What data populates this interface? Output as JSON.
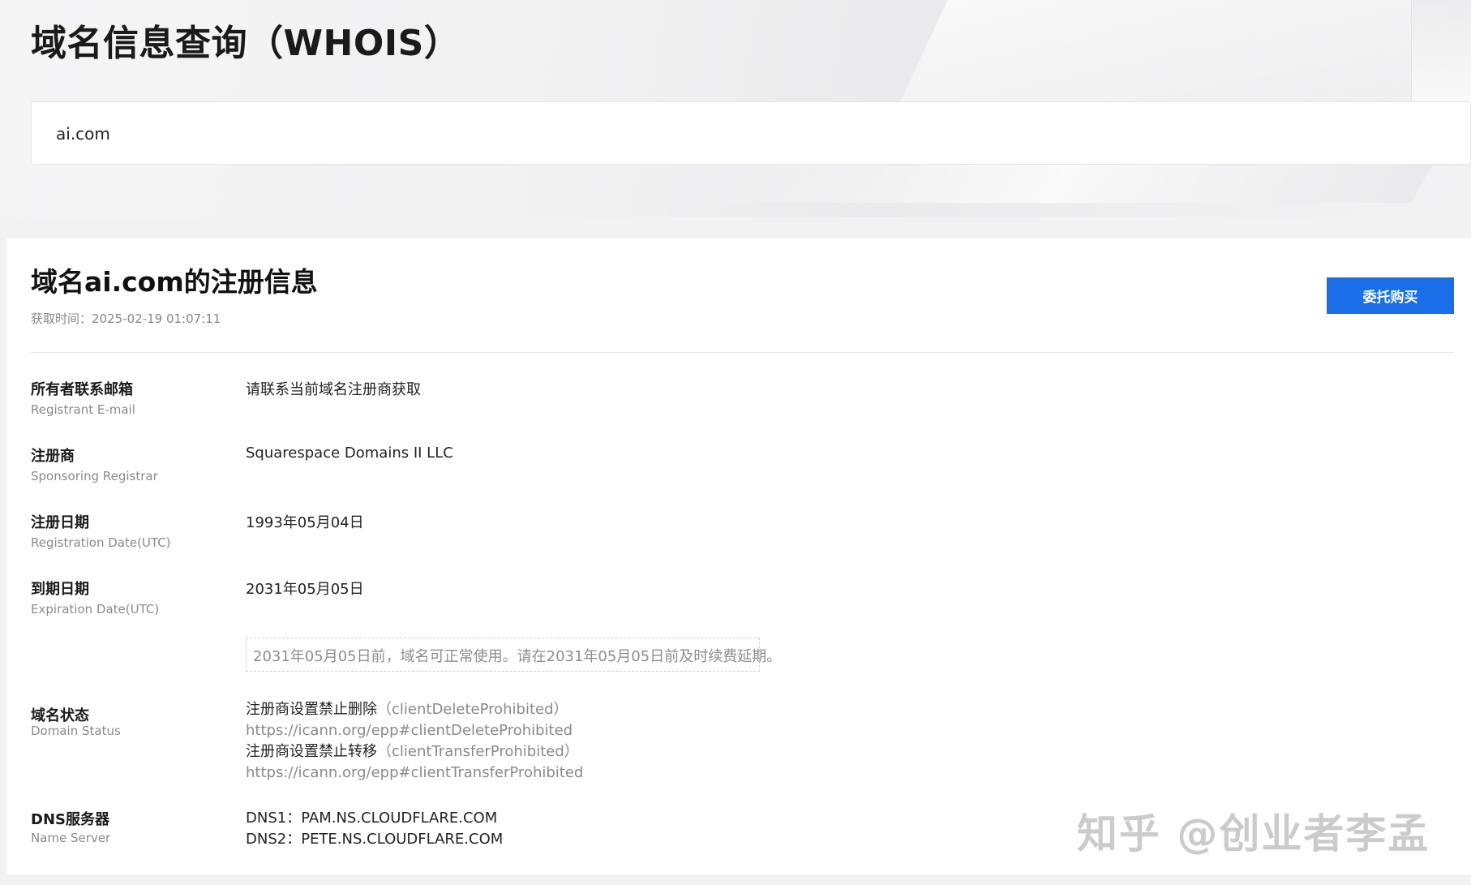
{
  "hero": {
    "title": "域名信息查询（WHOIS）",
    "search_value": "ai.com"
  },
  "result": {
    "title": "域名ai.com的注册信息",
    "fetch_time_label": "获取时间：",
    "fetch_time_value": "2025-02-19 01:07:11",
    "buy_button": "委托购买"
  },
  "fields": {
    "email": {
      "label_cn": "所有者联系邮箱",
      "label_en": "Registrant E-mail",
      "value": "请联系当前域名注册商获取"
    },
    "registrar": {
      "label_cn": "注册商",
      "label_en": "Sponsoring Registrar",
      "value": "Squarespace Domains II LLC"
    },
    "reg_date": {
      "label_cn": "注册日期",
      "label_en": "Registration Date(UTC)",
      "value": "1993年05月04日"
    },
    "exp_date": {
      "label_cn": "到期日期",
      "label_en": "Expiration Date(UTC)",
      "value": "2031年05月05日"
    },
    "notice": "2031年05月05日前，域名可正常使用。请在2031年05月05日前及时续费延期。",
    "status": {
      "label_cn": "域名状态",
      "label_en": "Domain Status",
      "items": [
        {
          "text": "注册商设置禁止删除",
          "code": "（clientDeleteProhibited）",
          "link": "https://icann.org/epp#clientDeleteProhibited"
        },
        {
          "text": "注册商设置禁止转移",
          "code": "（clientTransferProhibited）",
          "link": "https://icann.org/epp#clientTransferProhibited"
        }
      ]
    },
    "dns": {
      "label_cn": "DNS服务器",
      "label_en": "Name Server",
      "items": [
        "DNS1：PAM.NS.CLOUDFLARE.COM",
        "DNS2：PETE.NS.CLOUDFLARE.COM"
      ]
    }
  },
  "watermark": "知乎 @创业者李孟"
}
